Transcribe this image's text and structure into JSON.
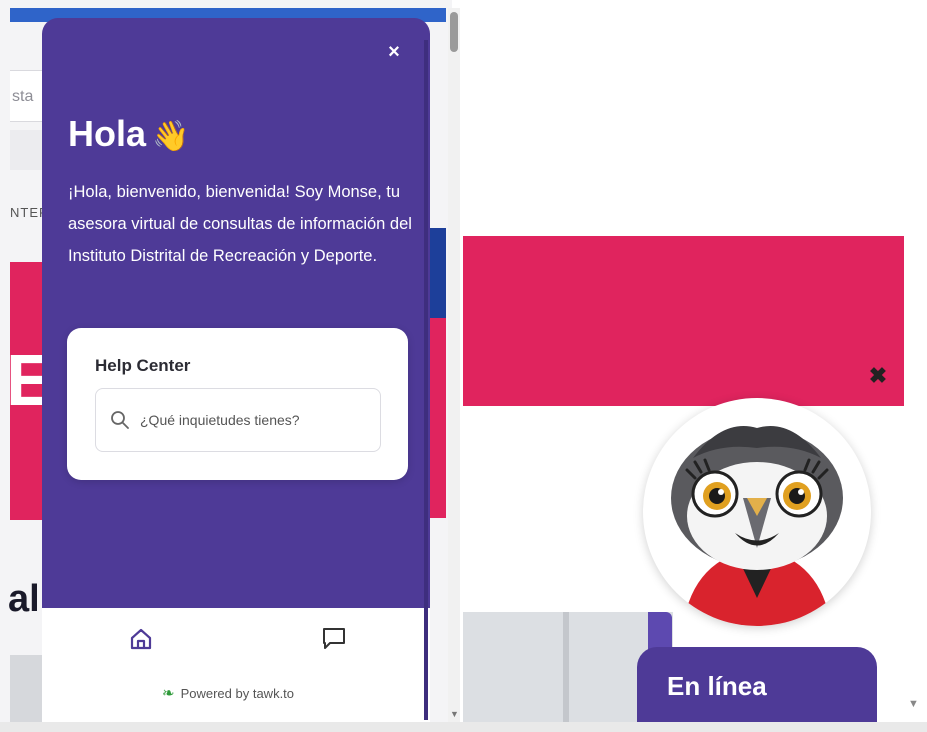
{
  "background": {
    "search_fragment": "sta",
    "nav_fragment": "NTER",
    "hero_fragment": "E",
    "heading_fragment": "al"
  },
  "widget": {
    "greeting": "Hola",
    "greeting_emoji": "👋",
    "welcome_message": "¡Hola, bienvenido, bienvenida! Soy Monse, tu asesora virtual de consultas de información del Instituto Distrital de Recreación y Deporte.",
    "close_label": "×",
    "help_center": {
      "title": "Help Center",
      "search_placeholder": "¿Qué inquietudes tienes?"
    },
    "footer": {
      "home_icon": "home-icon",
      "chat_icon": "chat-bubble-icon",
      "powered_by": "Powered by tawk.to"
    },
    "colors": {
      "primary": "#4e3a97",
      "accent_pink": "#e0245e"
    }
  },
  "launcher": {
    "close_label": "✖",
    "status_label": "En línea",
    "avatar": "owl-mascot-avatar"
  }
}
